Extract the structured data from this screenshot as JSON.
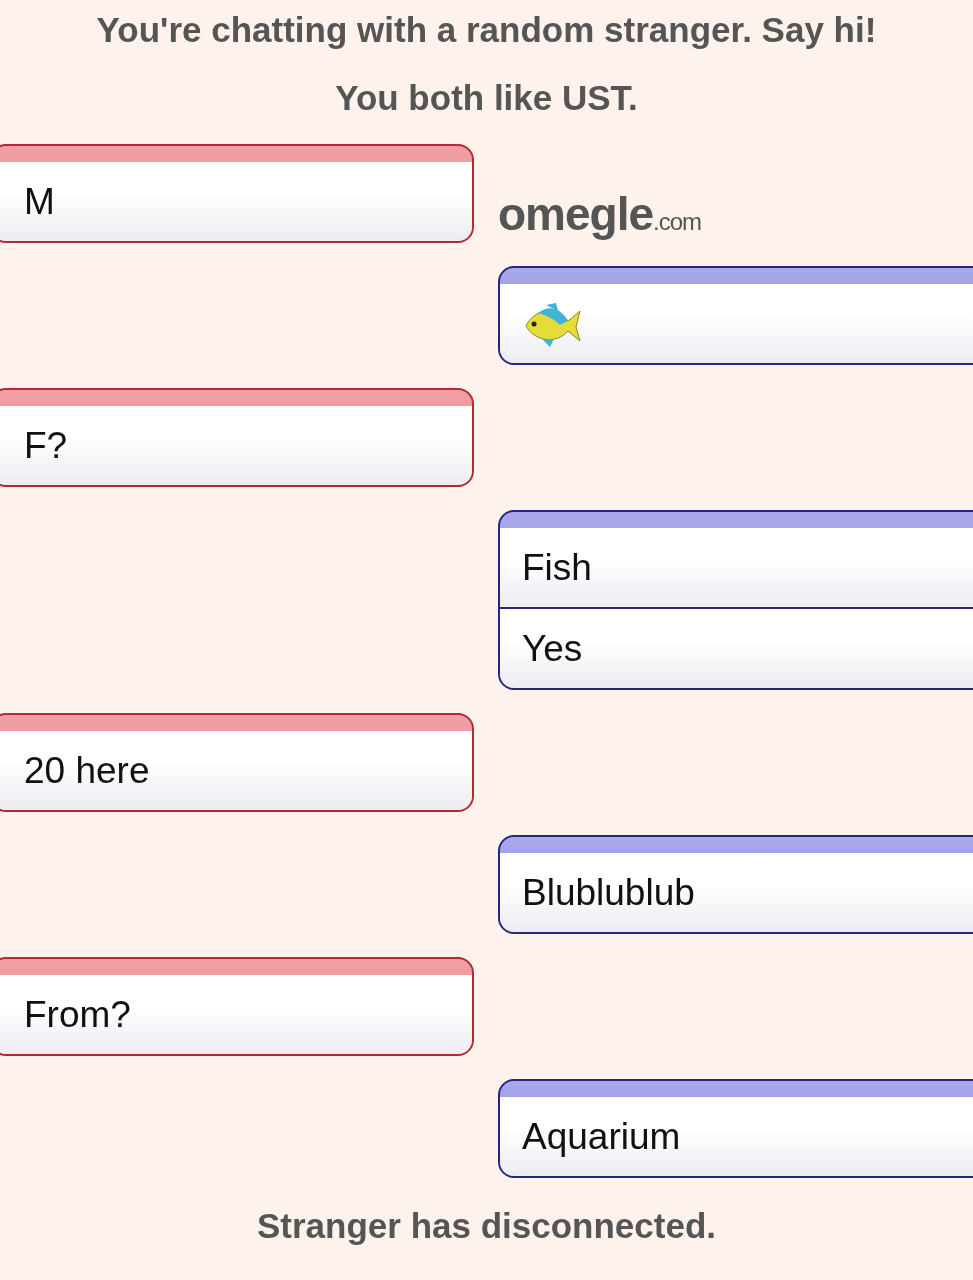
{
  "header": [
    "You're chatting with a random stranger. Say hi!",
    "You both like UST."
  ],
  "logo": {
    "name": "omegle",
    "suffix": ".com"
  },
  "messages": [
    {
      "kind": "you",
      "lines": [
        {
          "kind": "text",
          "text": "M"
        }
      ]
    },
    {
      "kind": "stranger",
      "lines": [
        {
          "kind": "fish"
        }
      ]
    },
    {
      "kind": "you",
      "lines": [
        {
          "kind": "text",
          "text": "F?"
        }
      ]
    },
    {
      "kind": "stranger",
      "lines": [
        {
          "kind": "text",
          "text": "Fish"
        },
        {
          "kind": "text",
          "text": "Yes"
        }
      ]
    },
    {
      "kind": "you",
      "lines": [
        {
          "kind": "text",
          "text": "20 here"
        }
      ]
    },
    {
      "kind": "stranger",
      "lines": [
        {
          "kind": "text",
          "text": "Blublublub"
        }
      ]
    },
    {
      "kind": "you",
      "lines": [
        {
          "kind": "text",
          "text": "From?"
        }
      ]
    },
    {
      "kind": "stranger",
      "lines": [
        {
          "kind": "text",
          "text": "Aquarium"
        }
      ]
    }
  ],
  "footer": "Stranger has disconnected."
}
